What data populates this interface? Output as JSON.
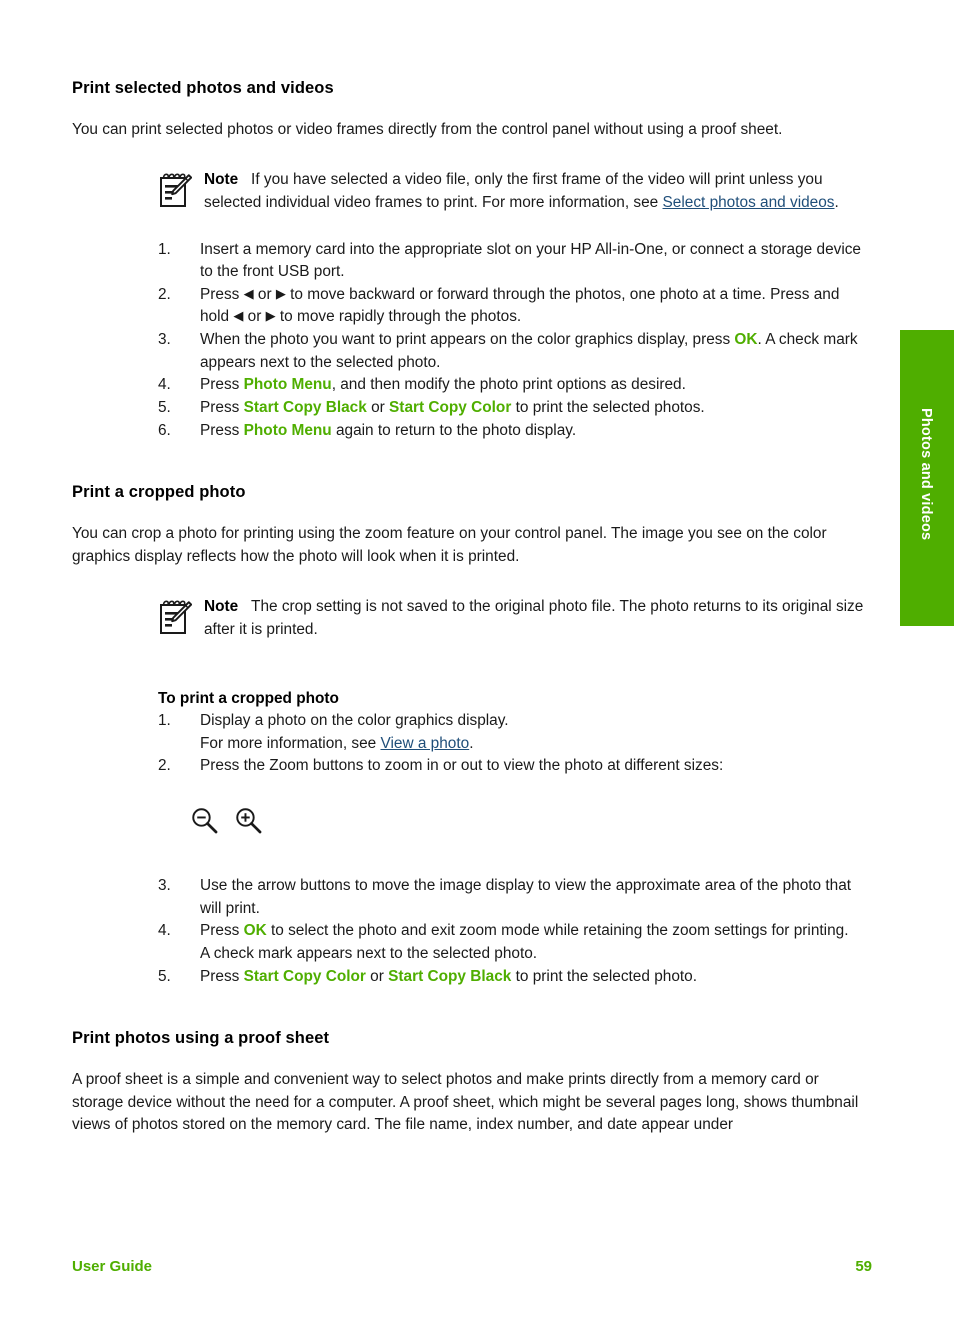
{
  "page": {
    "side_tab_label": "Photos and videos",
    "accent_green": "#4fae00",
    "link_blue": "#1f4e79"
  },
  "sections": [
    {
      "heading": "Print selected photos and videos",
      "intro": "You can print selected photos or video frames directly from the control panel without using a proof sheet.",
      "note": {
        "label": "Note",
        "text_1": "If you have selected a video file, only the first frame of the video will print unless you selected individual video frames to print. For more information, see ",
        "link": "Select photos and videos",
        "text_2": "."
      },
      "steps": [
        {
          "num": "1.",
          "parts": [
            {
              "type": "text",
              "value": "Insert a memory card into the appropriate slot on your HP All-in-One, or connect a storage device to the front USB port."
            }
          ]
        },
        {
          "num": "2.",
          "parts": [
            {
              "type": "text",
              "value": "Press "
            },
            {
              "type": "arrow",
              "value": "◀"
            },
            {
              "type": "text",
              "value": " or "
            },
            {
              "type": "arrow",
              "value": "▶"
            },
            {
              "type": "text",
              "value": " to move backward or forward through the photos, one photo at a time. Press and hold "
            },
            {
              "type": "arrow",
              "value": "◀"
            },
            {
              "type": "text",
              "value": " or "
            },
            {
              "type": "arrow",
              "value": "▶"
            },
            {
              "type": "text",
              "value": " to move rapidly through the photos."
            }
          ]
        },
        {
          "num": "3.",
          "parts": [
            {
              "type": "text",
              "value": "When the photo you want to print appears on the color graphics display, press "
            },
            {
              "type": "ui",
              "value": "OK"
            },
            {
              "type": "text",
              "value": ". A check mark appears next to the selected photo."
            }
          ]
        },
        {
          "num": "4.",
          "parts": [
            {
              "type": "text",
              "value": "Press "
            },
            {
              "type": "ui",
              "value": "Photo Menu"
            },
            {
              "type": "text",
              "value": ", and then modify the photo print options as desired."
            }
          ]
        },
        {
          "num": "5.",
          "parts": [
            {
              "type": "text",
              "value": "Press "
            },
            {
              "type": "ui",
              "value": "Start Copy Black"
            },
            {
              "type": "text",
              "value": " or "
            },
            {
              "type": "ui",
              "value": "Start Copy Color"
            },
            {
              "type": "text",
              "value": " to print the selected photos."
            }
          ]
        },
        {
          "num": "6.",
          "parts": [
            {
              "type": "text",
              "value": "Press "
            },
            {
              "type": "ui",
              "value": "Photo Menu"
            },
            {
              "type": "text",
              "value": " again to return to the photo display."
            }
          ]
        }
      ]
    },
    {
      "heading": "Print a cropped photo",
      "intro": "You can crop a photo for printing using the zoom feature on your control panel. The image you see on the color graphics display reflects how the photo will look when it is printed.",
      "note": {
        "label": "Note",
        "text_1": "The crop setting is not saved to the original photo file. The photo returns to its original size after it is printed.",
        "link": "",
        "text_2": ""
      },
      "sub_heading": "To print a cropped photo",
      "steps": [
        {
          "num": "1.",
          "parts": [
            {
              "type": "text",
              "value": "Display a photo on the color graphics display."
            },
            {
              "type": "break",
              "value": ""
            },
            {
              "type": "text",
              "value": "For more information, see "
            },
            {
              "type": "link",
              "value": "View a photo"
            },
            {
              "type": "text",
              "value": "."
            }
          ]
        },
        {
          "num": "2.",
          "parts": [
            {
              "type": "text",
              "value": "Press the Zoom buttons to zoom in or out to view the photo at different sizes:"
            }
          ]
        },
        {
          "num": "3.",
          "parts": [
            {
              "type": "text",
              "value": "Use the arrow buttons to move the image display to view the approximate area of the photo that will print."
            }
          ]
        },
        {
          "num": "4.",
          "parts": [
            {
              "type": "text",
              "value": "Press "
            },
            {
              "type": "ui",
              "value": "OK"
            },
            {
              "type": "text",
              "value": " to select the photo and exit zoom mode while retaining the zoom settings for printing."
            },
            {
              "type": "break",
              "value": ""
            },
            {
              "type": "text",
              "value": "A check mark appears next to the selected photo."
            }
          ]
        },
        {
          "num": "5.",
          "parts": [
            {
              "type": "text",
              "value": "Press "
            },
            {
              "type": "ui",
              "value": "Start Copy Color"
            },
            {
              "type": "text",
              "value": " or "
            },
            {
              "type": "ui",
              "value": "Start Copy Black"
            },
            {
              "type": "text",
              "value": " to print the selected photo."
            }
          ]
        }
      ],
      "zoom_icons": [
        {
          "name": "zoom-out-icon",
          "glyph": "minus"
        },
        {
          "name": "zoom-in-icon",
          "glyph": "plus"
        }
      ]
    },
    {
      "heading": "Print photos using a proof sheet",
      "intro": "A proof sheet is a simple and convenient way to select photos and make prints directly from a memory card or storage device without the need for a computer. A proof sheet, which might be several pages long, shows thumbnail views of photos stored on the memory card. The file name, index number, and date appear under"
    }
  ],
  "footer": {
    "left": "User Guide",
    "page_number": "59"
  }
}
